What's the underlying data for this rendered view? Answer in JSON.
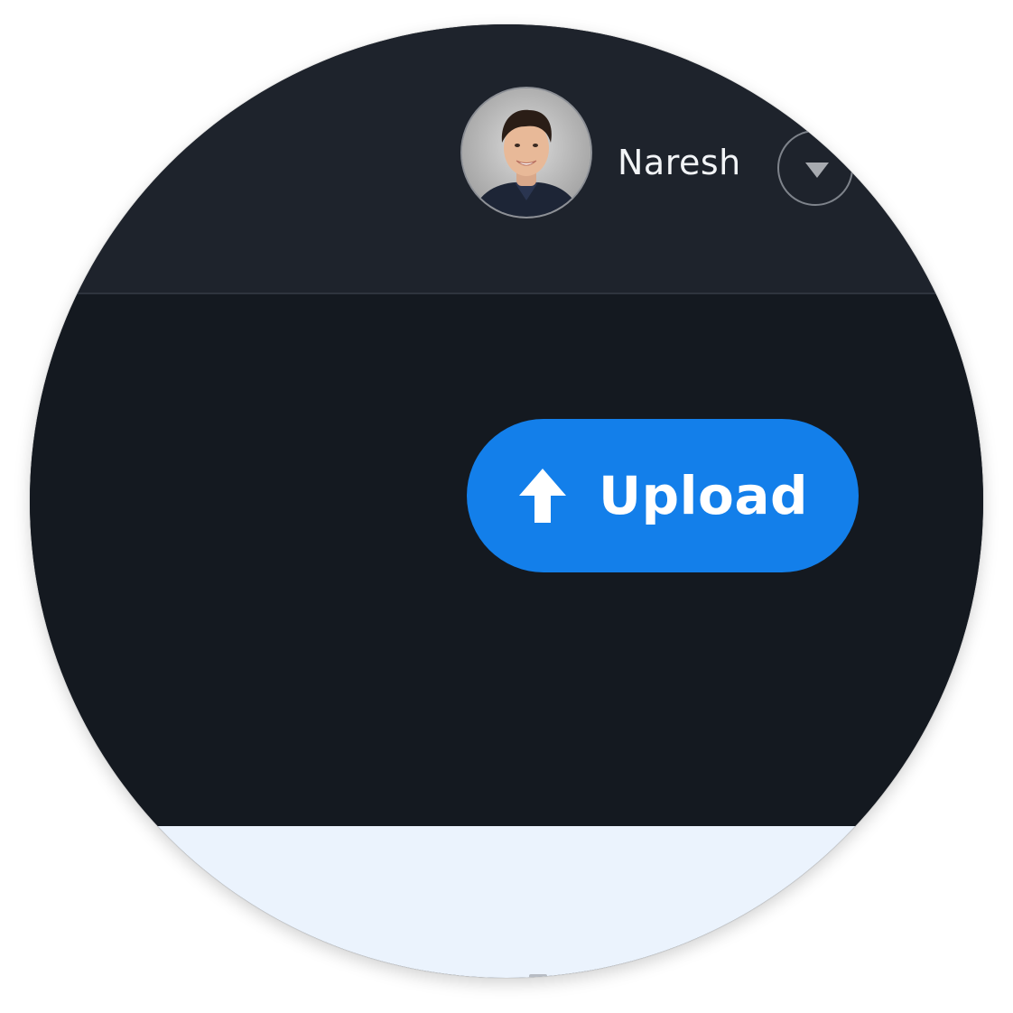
{
  "header": {
    "user": {
      "name": "Naresh",
      "avatar_icon": "user-photo-icon"
    },
    "menu_icon": "chevron-down-icon"
  },
  "toolbar": {
    "upload_label": "Upload",
    "upload_icon": "upload-arrow-icon"
  },
  "colors": {
    "header_bg": "#1e232c",
    "main_bg": "#141920",
    "content_bg": "#ebf3fd",
    "accent": "#137fea",
    "text": "#f2f4f7"
  }
}
